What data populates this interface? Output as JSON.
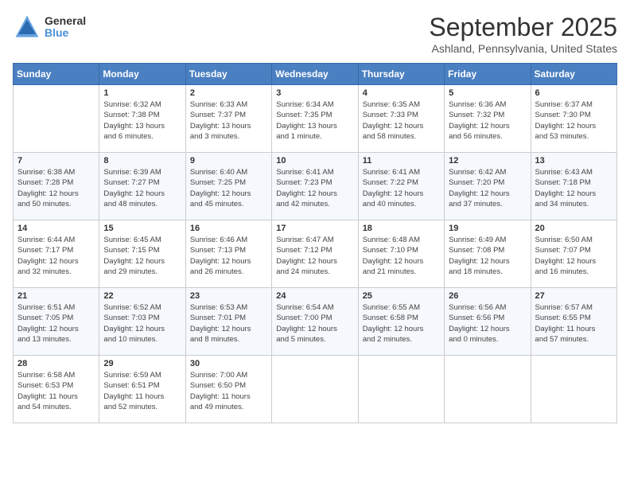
{
  "header": {
    "logo": {
      "general": "General",
      "blue": "Blue"
    },
    "title": "September 2025",
    "location": "Ashland, Pennsylvania, United States"
  },
  "columns": [
    "Sunday",
    "Monday",
    "Tuesday",
    "Wednesday",
    "Thursday",
    "Friday",
    "Saturday"
  ],
  "weeks": [
    [
      {
        "num": "",
        "info": ""
      },
      {
        "num": "1",
        "info": "Sunrise: 6:32 AM\nSunset: 7:38 PM\nDaylight: 13 hours\nand 6 minutes."
      },
      {
        "num": "2",
        "info": "Sunrise: 6:33 AM\nSunset: 7:37 PM\nDaylight: 13 hours\nand 3 minutes."
      },
      {
        "num": "3",
        "info": "Sunrise: 6:34 AM\nSunset: 7:35 PM\nDaylight: 13 hours\nand 1 minute."
      },
      {
        "num": "4",
        "info": "Sunrise: 6:35 AM\nSunset: 7:33 PM\nDaylight: 12 hours\nand 58 minutes."
      },
      {
        "num": "5",
        "info": "Sunrise: 6:36 AM\nSunset: 7:32 PM\nDaylight: 12 hours\nand 56 minutes."
      },
      {
        "num": "6",
        "info": "Sunrise: 6:37 AM\nSunset: 7:30 PM\nDaylight: 12 hours\nand 53 minutes."
      }
    ],
    [
      {
        "num": "7",
        "info": "Sunrise: 6:38 AM\nSunset: 7:28 PM\nDaylight: 12 hours\nand 50 minutes."
      },
      {
        "num": "8",
        "info": "Sunrise: 6:39 AM\nSunset: 7:27 PM\nDaylight: 12 hours\nand 48 minutes."
      },
      {
        "num": "9",
        "info": "Sunrise: 6:40 AM\nSunset: 7:25 PM\nDaylight: 12 hours\nand 45 minutes."
      },
      {
        "num": "10",
        "info": "Sunrise: 6:41 AM\nSunset: 7:23 PM\nDaylight: 12 hours\nand 42 minutes."
      },
      {
        "num": "11",
        "info": "Sunrise: 6:41 AM\nSunset: 7:22 PM\nDaylight: 12 hours\nand 40 minutes."
      },
      {
        "num": "12",
        "info": "Sunrise: 6:42 AM\nSunset: 7:20 PM\nDaylight: 12 hours\nand 37 minutes."
      },
      {
        "num": "13",
        "info": "Sunrise: 6:43 AM\nSunset: 7:18 PM\nDaylight: 12 hours\nand 34 minutes."
      }
    ],
    [
      {
        "num": "14",
        "info": "Sunrise: 6:44 AM\nSunset: 7:17 PM\nDaylight: 12 hours\nand 32 minutes."
      },
      {
        "num": "15",
        "info": "Sunrise: 6:45 AM\nSunset: 7:15 PM\nDaylight: 12 hours\nand 29 minutes."
      },
      {
        "num": "16",
        "info": "Sunrise: 6:46 AM\nSunset: 7:13 PM\nDaylight: 12 hours\nand 26 minutes."
      },
      {
        "num": "17",
        "info": "Sunrise: 6:47 AM\nSunset: 7:12 PM\nDaylight: 12 hours\nand 24 minutes."
      },
      {
        "num": "18",
        "info": "Sunrise: 6:48 AM\nSunset: 7:10 PM\nDaylight: 12 hours\nand 21 minutes."
      },
      {
        "num": "19",
        "info": "Sunrise: 6:49 AM\nSunset: 7:08 PM\nDaylight: 12 hours\nand 18 minutes."
      },
      {
        "num": "20",
        "info": "Sunrise: 6:50 AM\nSunset: 7:07 PM\nDaylight: 12 hours\nand 16 minutes."
      }
    ],
    [
      {
        "num": "21",
        "info": "Sunrise: 6:51 AM\nSunset: 7:05 PM\nDaylight: 12 hours\nand 13 minutes."
      },
      {
        "num": "22",
        "info": "Sunrise: 6:52 AM\nSunset: 7:03 PM\nDaylight: 12 hours\nand 10 minutes."
      },
      {
        "num": "23",
        "info": "Sunrise: 6:53 AM\nSunset: 7:01 PM\nDaylight: 12 hours\nand 8 minutes."
      },
      {
        "num": "24",
        "info": "Sunrise: 6:54 AM\nSunset: 7:00 PM\nDaylight: 12 hours\nand 5 minutes."
      },
      {
        "num": "25",
        "info": "Sunrise: 6:55 AM\nSunset: 6:58 PM\nDaylight: 12 hours\nand 2 minutes."
      },
      {
        "num": "26",
        "info": "Sunrise: 6:56 AM\nSunset: 6:56 PM\nDaylight: 12 hours\nand 0 minutes."
      },
      {
        "num": "27",
        "info": "Sunrise: 6:57 AM\nSunset: 6:55 PM\nDaylight: 11 hours\nand 57 minutes."
      }
    ],
    [
      {
        "num": "28",
        "info": "Sunrise: 6:58 AM\nSunset: 6:53 PM\nDaylight: 11 hours\nand 54 minutes."
      },
      {
        "num": "29",
        "info": "Sunrise: 6:59 AM\nSunset: 6:51 PM\nDaylight: 11 hours\nand 52 minutes."
      },
      {
        "num": "30",
        "info": "Sunrise: 7:00 AM\nSunset: 6:50 PM\nDaylight: 11 hours\nand 49 minutes."
      },
      {
        "num": "",
        "info": ""
      },
      {
        "num": "",
        "info": ""
      },
      {
        "num": "",
        "info": ""
      },
      {
        "num": "",
        "info": ""
      }
    ]
  ]
}
